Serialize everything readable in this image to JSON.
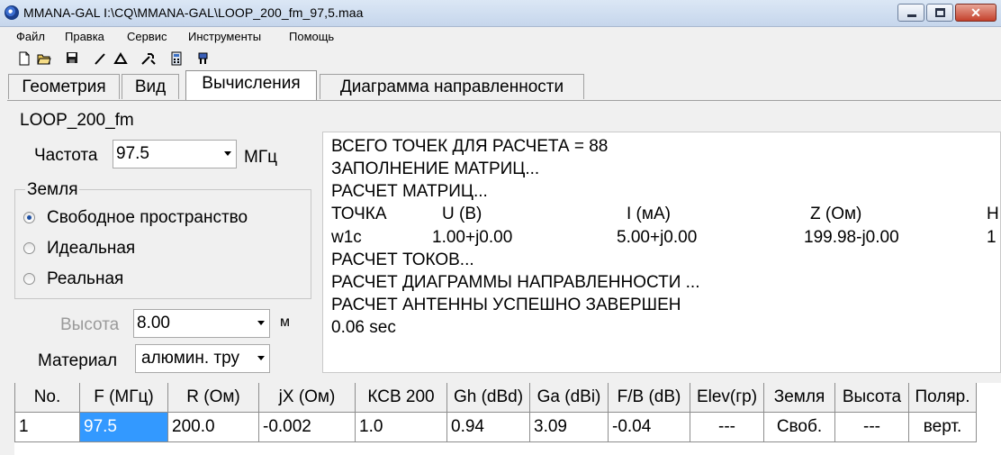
{
  "window": {
    "title": "MMANA-GAL I:\\CQ\\MMANA-GAL\\LOOP_200_fm_97,5.maa",
    "close_glyph": "✕"
  },
  "menu": [
    "Файл",
    "Правка",
    "Сервис",
    "Инструменты",
    "Помощь"
  ],
  "toolbar_icons": [
    "new-file-icon",
    "open-folder-icon",
    "save-icon",
    "line-icon",
    "triangle-icon",
    "tools-icon",
    "calculator-icon",
    "antenna-icon"
  ],
  "tabs": [
    "Геометрия",
    "Вид",
    "Вычисления",
    "Диаграмма направленности"
  ],
  "active_tab": "Вычисления",
  "calc": {
    "file_name": "LOOP_200_fm",
    "frequency_label": "Частота",
    "frequency_value": "97.5",
    "frequency_unit": "МГц",
    "ground_group_title": "Земля",
    "ground_options": [
      "Свободное пространство",
      "Идеальная",
      "Реальная"
    ],
    "ground_selected": "Свободное пространство",
    "height_label": "Высота",
    "height_value": "8.00",
    "height_unit": "м",
    "material_label": "Материал",
    "material_value": "алюмин. тру"
  },
  "console": {
    "lines": [
      "ВСЕГО ТОЧЕК ДЛЯ РАСЧЕТА = 88",
      "ЗАПОЛНЕНИЕ МАТРИЦ...",
      "РАСЧЕТ МАТРИЦ..."
    ],
    "table_header": [
      "ТОЧКА",
      "U (В)",
      "I (мА)",
      "Z (Ом)",
      "H"
    ],
    "table_row": [
      "w1c",
      "1.00+j0.00",
      "5.00+j0.00",
      "199.98-j0.00",
      "1"
    ],
    "tail_lines": [
      "РАСЧЕТ ТОКОВ...",
      "РАСЧЕТ ДИАГРАММЫ НАПРАВЛЕННОСТИ ...",
      "РАСЧЕТ АНТЕННЫ УСПЕШНО ЗАВЕРШЕН",
      "0.06 sec"
    ]
  },
  "results": {
    "columns": [
      "No.",
      "F (МГц)",
      "R (Ом)",
      "jX (Ом)",
      "КСВ 200",
      "Gh (dBd)",
      "Ga (dBi)",
      "F/B (dB)",
      "Elev(гр)",
      "Земля",
      "Высота",
      "Поляр."
    ],
    "rows": [
      [
        "1",
        "97.5",
        "200.0",
        "-0.002",
        "1.0",
        "0.94",
        "3.09",
        "-0.04",
        "---",
        "Своб.",
        "---",
        "верт."
      ]
    ],
    "selected_cell": "F (МГц)"
  }
}
